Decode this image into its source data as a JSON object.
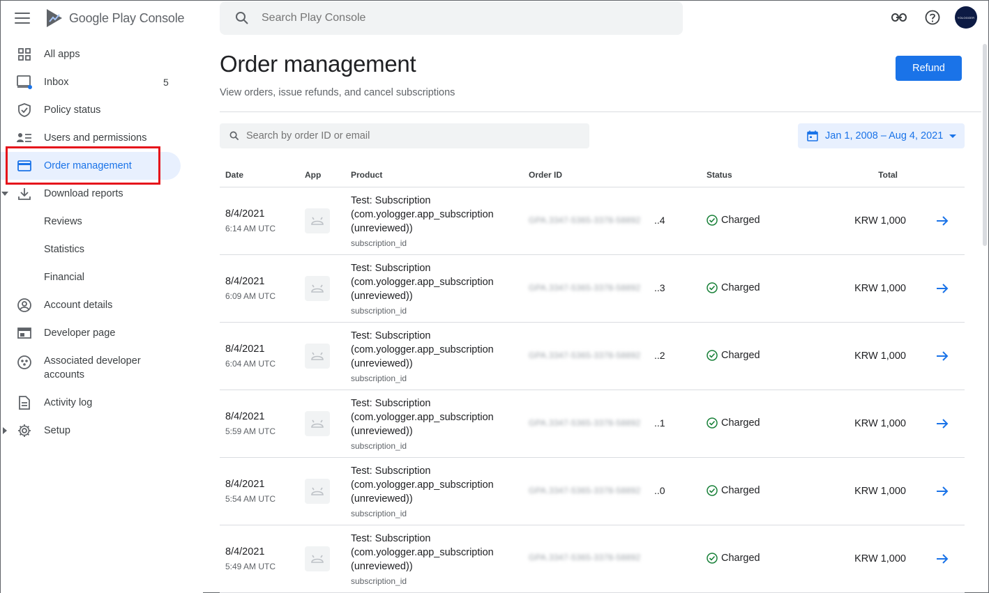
{
  "app": {
    "brand_google": "Google Play",
    "brand_console": "Console"
  },
  "top_search": {
    "placeholder": "Search Play Console"
  },
  "avatar": {
    "text": "YOLOGGER"
  },
  "sidebar": {
    "items": [
      {
        "label": "All apps",
        "icon": "grid-icon"
      },
      {
        "label": "Inbox",
        "icon": "inbox-icon",
        "badge": "5"
      },
      {
        "label": "Policy status",
        "icon": "shield-icon"
      },
      {
        "label": "Users and permissions",
        "icon": "people-icon"
      },
      {
        "label": "Order management",
        "icon": "credit-card-icon",
        "active": true
      },
      {
        "label": "Download reports",
        "icon": "download-icon"
      },
      {
        "label": "Reviews"
      },
      {
        "label": "Statistics"
      },
      {
        "label": "Financial"
      },
      {
        "label": "Account details",
        "icon": "account-circle-icon"
      },
      {
        "label": "Developer page",
        "icon": "web-page-icon"
      },
      {
        "label": "Associated developer accounts",
        "icon": "group-circle-icon"
      },
      {
        "label": "Activity log",
        "icon": "document-icon"
      },
      {
        "label": "Setup",
        "icon": "gear-icon"
      }
    ]
  },
  "main": {
    "title": "Order management",
    "subtitle": "View orders, issue refunds, and cancel subscriptions",
    "refund_label": "Refund",
    "order_search_placeholder": "Search by order ID or email",
    "date_range": "Jan 1, 2008 – Aug 4, 2021"
  },
  "table": {
    "headers": {
      "date": "Date",
      "app": "App",
      "product": "Product",
      "order_id": "Order ID",
      "status": "Status",
      "total": "Total"
    },
    "rows": [
      {
        "date": "8/4/2021",
        "time": "6:14 AM UTC",
        "product": "Test: Subscription (com.yologger.app_subscription (unreviewed))",
        "product_id": "subscription_id",
        "order_blur": "GPA.3347-5365-3378-58892",
        "order_suffix": "..4",
        "status": "Charged",
        "total": "KRW 1,000"
      },
      {
        "date": "8/4/2021",
        "time": "6:09 AM UTC",
        "product": "Test: Subscription (com.yologger.app_subscription (unreviewed))",
        "product_id": "subscription_id",
        "order_blur": "GPA.3347-5365-3378-58892",
        "order_suffix": "..3",
        "status": "Charged",
        "total": "KRW 1,000"
      },
      {
        "date": "8/4/2021",
        "time": "6:04 AM UTC",
        "product": "Test: Subscription (com.yologger.app_subscription (unreviewed))",
        "product_id": "subscription_id",
        "order_blur": "GPA.3347-5365-3378-58892",
        "order_suffix": "..2",
        "status": "Charged",
        "total": "KRW 1,000"
      },
      {
        "date": "8/4/2021",
        "time": "5:59 AM UTC",
        "product": "Test: Subscription (com.yologger.app_subscription (unreviewed))",
        "product_id": "subscription_id",
        "order_blur": "GPA.3347-5365-3378-58892",
        "order_suffix": "..1",
        "status": "Charged",
        "total": "KRW 1,000"
      },
      {
        "date": "8/4/2021",
        "time": "5:54 AM UTC",
        "product": "Test: Subscription (com.yologger.app_subscription (unreviewed))",
        "product_id": "subscription_id",
        "order_blur": "GPA.3347-5365-3378-58892",
        "order_suffix": "..0",
        "status": "Charged",
        "total": "KRW 1,000"
      },
      {
        "date": "8/4/2021",
        "time": "5:49 AM UTC",
        "product": "Test: Subscription (com.yologger.app_subscription (unreviewed))",
        "product_id": "subscription_id",
        "order_blur": "GPA.3347-5365-3378-58892",
        "order_suffix": "",
        "status": "Charged",
        "total": "KRW 1,000"
      }
    ]
  },
  "colors": {
    "accent": "#1a73e8",
    "highlight": "#e5131b",
    "charged": "#188038"
  }
}
